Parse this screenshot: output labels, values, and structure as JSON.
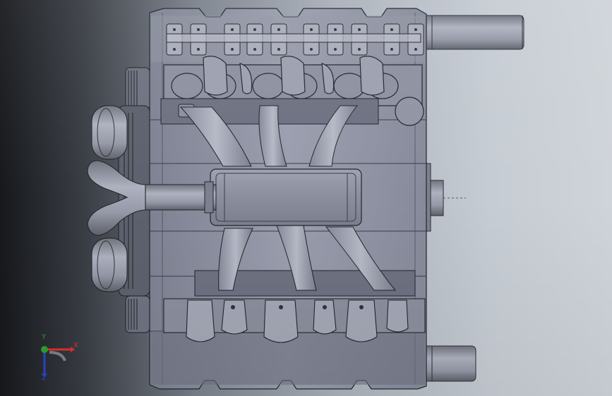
{
  "triad": {
    "x_label": "X",
    "y_label": "Y",
    "z_label": "Z",
    "x_color": "#e03030",
    "y_color": "#2ca02c",
    "z_color": "#2a45c8"
  },
  "colors": {
    "background_dark": "#16181c",
    "background_light": "#cfd4da",
    "part_fill": "#8a8e9e",
    "part_edge": "#2a2c33"
  }
}
